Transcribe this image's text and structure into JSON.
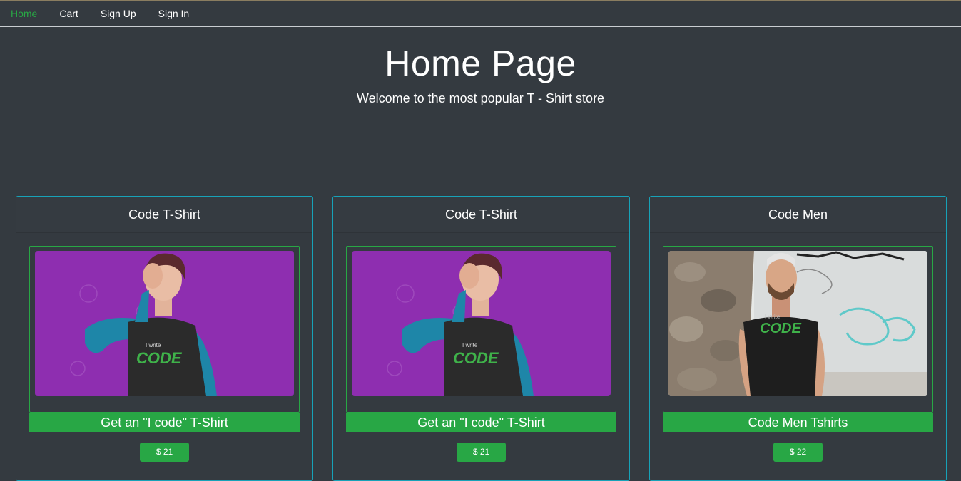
{
  "nav": {
    "items": [
      {
        "label": "Home",
        "active": true
      },
      {
        "label": "Cart",
        "active": false
      },
      {
        "label": "Sign Up",
        "active": false
      },
      {
        "label": "Sign In",
        "active": false
      }
    ]
  },
  "hero": {
    "title": "Home Page",
    "subtitle": "Welcome to the most popular T - Shirt store"
  },
  "products": [
    {
      "header": "Code T-Shirt",
      "image_alt": "woman in raglan t-shirt with 'I write CODE' print on purple background",
      "image_shirt_small_text": "I write",
      "image_shirt_big_text": "CODE",
      "title": "Get an \"I code\" T-Shirt",
      "price": "$ 21"
    },
    {
      "header": "Code T-Shirt",
      "image_alt": "woman in raglan t-shirt with 'I write CODE' print on purple background",
      "image_shirt_small_text": "I write",
      "image_shirt_big_text": "CODE",
      "title": "Get an \"I code\" T-Shirt",
      "price": "$ 21"
    },
    {
      "header": "Code Men",
      "image_alt": "man in black t-shirt with 'I write CODE' print in front of graffiti wall",
      "image_shirt_small_text": "I write",
      "image_shirt_big_text": "CODE",
      "title": "Code Men Tshirts",
      "price": "$ 22"
    }
  ],
  "colors": {
    "background": "#343a40",
    "accent_green": "#28a745",
    "card_border": "#17a2b8",
    "purple_backdrop": "#8e2eb0"
  }
}
